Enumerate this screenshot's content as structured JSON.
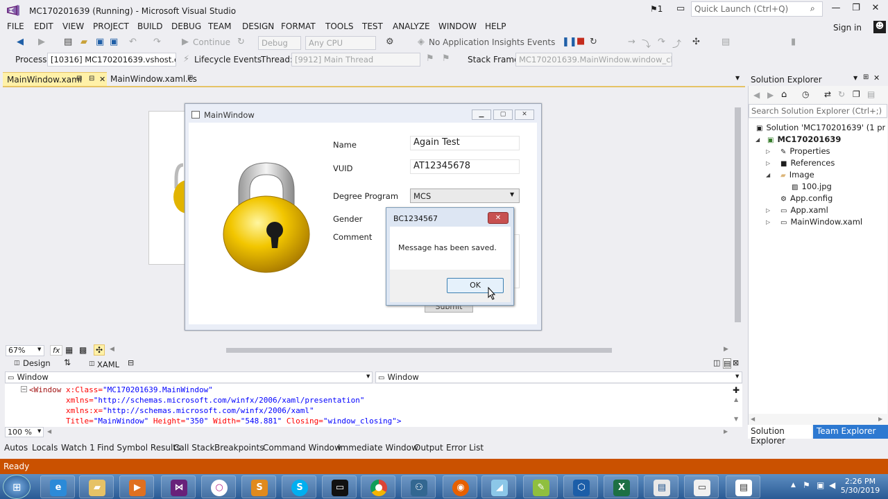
{
  "window": {
    "title": "MC170201639 (Running) - Microsoft Visual Studio",
    "flag_count": "1",
    "quick_launch_placeholder": "Quick Launch (Ctrl+Q)",
    "sign_in": "Sign in"
  },
  "menu": [
    "FILE",
    "EDIT",
    "VIEW",
    "PROJECT",
    "BUILD",
    "DEBUG",
    "TEAM",
    "DESIGN",
    "FORMAT",
    "TOOLS",
    "TEST",
    "ANALYZE",
    "WINDOW",
    "HELP"
  ],
  "toolbar1": {
    "continue": "Continue",
    "config": "Debug",
    "platform": "Any CPU",
    "insights": "No Application Insights Events"
  },
  "toolbar2": {
    "process_label": "Process:",
    "process_value": "[10316] MC170201639.vshost.exe",
    "lifecycle": "Lifecycle Events",
    "thread_label": "Thread:",
    "thread_value": "[9912] Main Thread",
    "stack_label": "Stack Frame:",
    "stack_value": "MC170201639.MainWindow.window_closi"
  },
  "doc_tabs": [
    "MainWindow.xaml",
    "MainWindow.xaml.cs"
  ],
  "app_window": {
    "title": "MainWindow",
    "name_label": "Name",
    "name_value": "Again Test",
    "vuid_label": "VUID",
    "vuid_value": "AT12345678",
    "degree_label": "Degree Program",
    "degree_value": "MCS",
    "gender_label": "Gender",
    "comment_label": "Comment",
    "submit": "Submit"
  },
  "message_box": {
    "title": "BC1234567",
    "text": "Message has been saved.",
    "ok": "OK"
  },
  "designer": {
    "zoom": "67%",
    "design_tab": "Design",
    "xaml_tab": "XAML",
    "left_combo": "Window",
    "right_combo": "Window",
    "editor_zoom": "100 %"
  },
  "code_lines": [
    {
      "tag": "<Window",
      "attr": " x:Class=",
      "val": "\"MC170201639.MainWindow\""
    },
    {
      "attr": "xmlns=",
      "val": "\"http://schemas.microsoft.com/winfx/2006/xaml/presentation\""
    },
    {
      "attr": "xmlns:x=",
      "val": "\"http://schemas.microsoft.com/winfx/2006/xaml\""
    },
    {
      "attr1": "Title=",
      "val1": "\"MainWindow\"",
      "attr2": " Height=",
      "val2": "\"350\"",
      "attr3": " Width=",
      "val3": "\"548.881\"",
      "attr4": " Closing=",
      "val4": "\"window_closing\"",
      "end": ">"
    }
  ],
  "tool_tabs": [
    "Autos",
    "Locals",
    "Watch 1",
    "Find Symbol Results",
    "Call Stack",
    "Breakpoints",
    "Command Window",
    "Immediate Window",
    "Output",
    "Error List"
  ],
  "solution_explorer": {
    "title": "Solution Explorer",
    "search_placeholder": "Search Solution Explorer (Ctrl+;)",
    "solution": "Solution 'MC170201639' (1 project)",
    "project": "MC170201639",
    "items": [
      "Properties",
      "References",
      "Image",
      "100.jpg",
      "App.config",
      "App.xaml",
      "MainWindow.xaml"
    ],
    "tab1": "Solution Explorer",
    "tab2": "Team Explorer"
  },
  "status": "Ready",
  "clock": {
    "time": "2:26 PM",
    "date": "5/30/2019"
  },
  "colors": {
    "accent": "#ca5100",
    "tab_active": "#fff1a8",
    "taskbar": "#2a5a94"
  }
}
